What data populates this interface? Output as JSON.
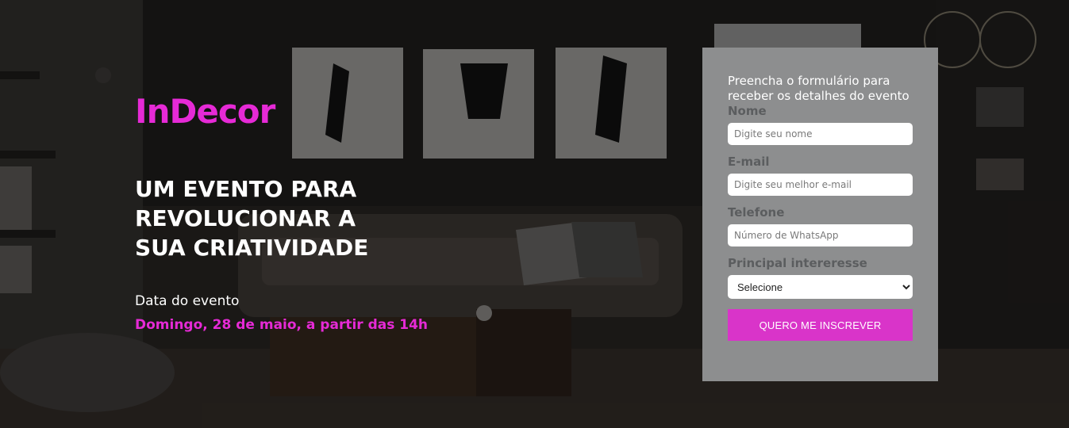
{
  "brand": {
    "name": "InDecor",
    "color": "#e62ad6"
  },
  "hero": {
    "headline_lines": [
      "UM EVENTO PARA",
      "REVOLUCIONAR A",
      "SUA CRIATIVIDADE"
    ],
    "date_label": "Data do evento",
    "date_value": "Domingo, 28 de maio, a partir das 14h"
  },
  "form": {
    "intro": "Preencha o formulário para receber os detalhes do evento",
    "name_label": "Nome",
    "name_placeholder": "Digite seu nome",
    "email_label": "E-mail",
    "email_placeholder": "Digite seu melhor e-mail",
    "phone_label": "Telefone",
    "phone_placeholder": "Número de WhatsApp",
    "interest_label": "Principal intereresse",
    "interest_selected": "Selecione",
    "submit_label": "QUERO ME INSCREVER",
    "background_color": "#8d8e8f",
    "button_color": "#d934c9"
  }
}
